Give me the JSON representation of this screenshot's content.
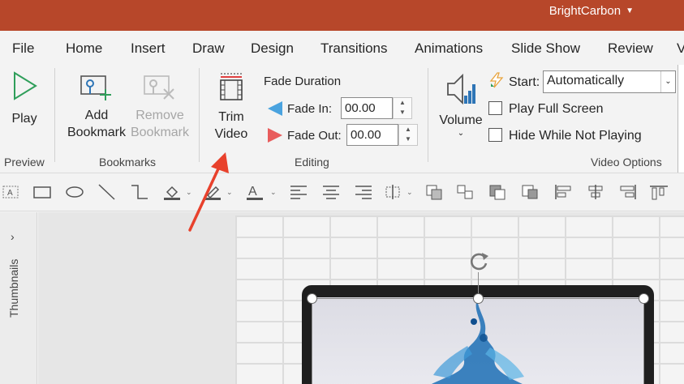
{
  "titlebar": {
    "account_name": "BrightCarbon"
  },
  "tabs": [
    "File",
    "Home",
    "Insert",
    "Draw",
    "Design",
    "Transitions",
    "Animations",
    "Slide Show",
    "Review",
    "V"
  ],
  "ribbon": {
    "preview": {
      "play_label": "Play",
      "group_label": "Preview"
    },
    "bookmarks": {
      "add_line1": "Add",
      "add_line2": "Bookmark",
      "remove_line1": "Remove",
      "remove_line2": "Bookmark",
      "group_label": "Bookmarks"
    },
    "editing": {
      "trim_line1": "Trim",
      "trim_line2": "Video",
      "fade_duration_label": "Fade Duration",
      "fade_in_label": "Fade In:",
      "fade_in_value": "00.00",
      "fade_out_label": "Fade Out:",
      "fade_out_value": "00.00",
      "group_label": "Editing"
    },
    "video_options": {
      "volume_label": "Volume",
      "start_label": "Start:",
      "start_value": "Automatically",
      "play_full_screen_label": "Play Full Screen",
      "hide_while_not_playing_label": "Hide While Not Playing",
      "group_label": "Video Options"
    }
  },
  "thumbnails": {
    "label": "Thumbnails"
  },
  "colors": {
    "titlebar": "#b7472a",
    "annotation_arrow": "#e8412c",
    "accent_blue": "#2e75b6",
    "fade_in_icon": "#4aa3df",
    "fade_out_icon": "#e85c5c"
  }
}
